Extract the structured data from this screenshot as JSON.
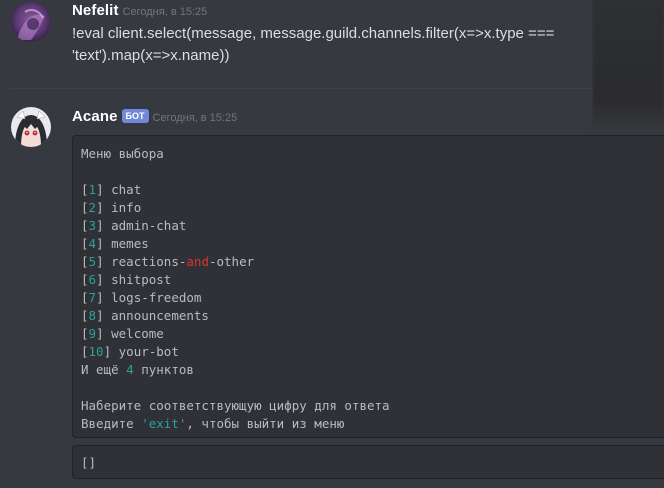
{
  "messages": [
    {
      "username": "Nefelit",
      "timestamp": "Сегодня, в 15:25",
      "content_line1": "!eval client.select(message, message.guild.channels.filter(x=>x.type ===",
      "content_line2": "'text').map(x=>x.name))"
    },
    {
      "username": "Acane",
      "bot_tag": "БОТ",
      "timestamp": "Сегодня, в 15:25",
      "menu": {
        "title": "Меню выбора",
        "items": [
          {
            "num": "1",
            "name": "chat"
          },
          {
            "num": "2",
            "name": "info"
          },
          {
            "num": "3",
            "name": "admin-chat"
          },
          {
            "num": "4",
            "name": "memes"
          },
          {
            "num": "5",
            "name_pre": "reactions-",
            "name_kw": "and",
            "name_post": "-other"
          },
          {
            "num": "6",
            "name": "shitpost"
          },
          {
            "num": "7",
            "name": "logs-freedom"
          },
          {
            "num": "8",
            "name": "announcements"
          },
          {
            "num": "9",
            "name": "welcome"
          },
          {
            "num": "10",
            "name": "your-bot"
          }
        ],
        "more_pre": "И ещё ",
        "more_count": "4",
        "more_post": " пунктов",
        "prompt": "Наберите соответствующую цифру для ответа",
        "exit_pre": "Введите ",
        "exit_kw": "'exit'",
        "exit_post": ", чтобы выйти из меню"
      },
      "second_block": "[]"
    }
  ],
  "colors": {
    "background": "#36393f",
    "code_background": "#2f3136",
    "code_number": "#2aa198",
    "code_keyword": "#dc322f",
    "bot_tag": "#7289da"
  }
}
